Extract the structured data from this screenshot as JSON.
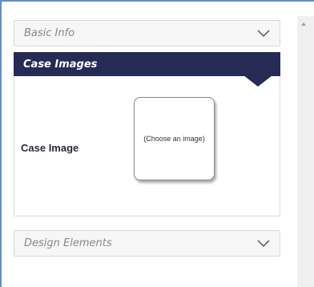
{
  "sections": {
    "basic_info": {
      "title": "Basic Info"
    },
    "case_images": {
      "title": "Case Images",
      "field_label": "Case Image",
      "image_placeholder": "(Choose an image)"
    },
    "design_elements": {
      "title": "Design Elements"
    }
  },
  "icons": {
    "basic_info_toggle": "chevron-down-icon",
    "design_elements_toggle": "chevron-down-icon",
    "scroll_up": "arrow-up-icon"
  },
  "colors": {
    "frame_border": "#5f8dc9",
    "active_header": "#262b55",
    "collapsed_header": "#f6f6f6",
    "collapsed_title": "#888888"
  }
}
